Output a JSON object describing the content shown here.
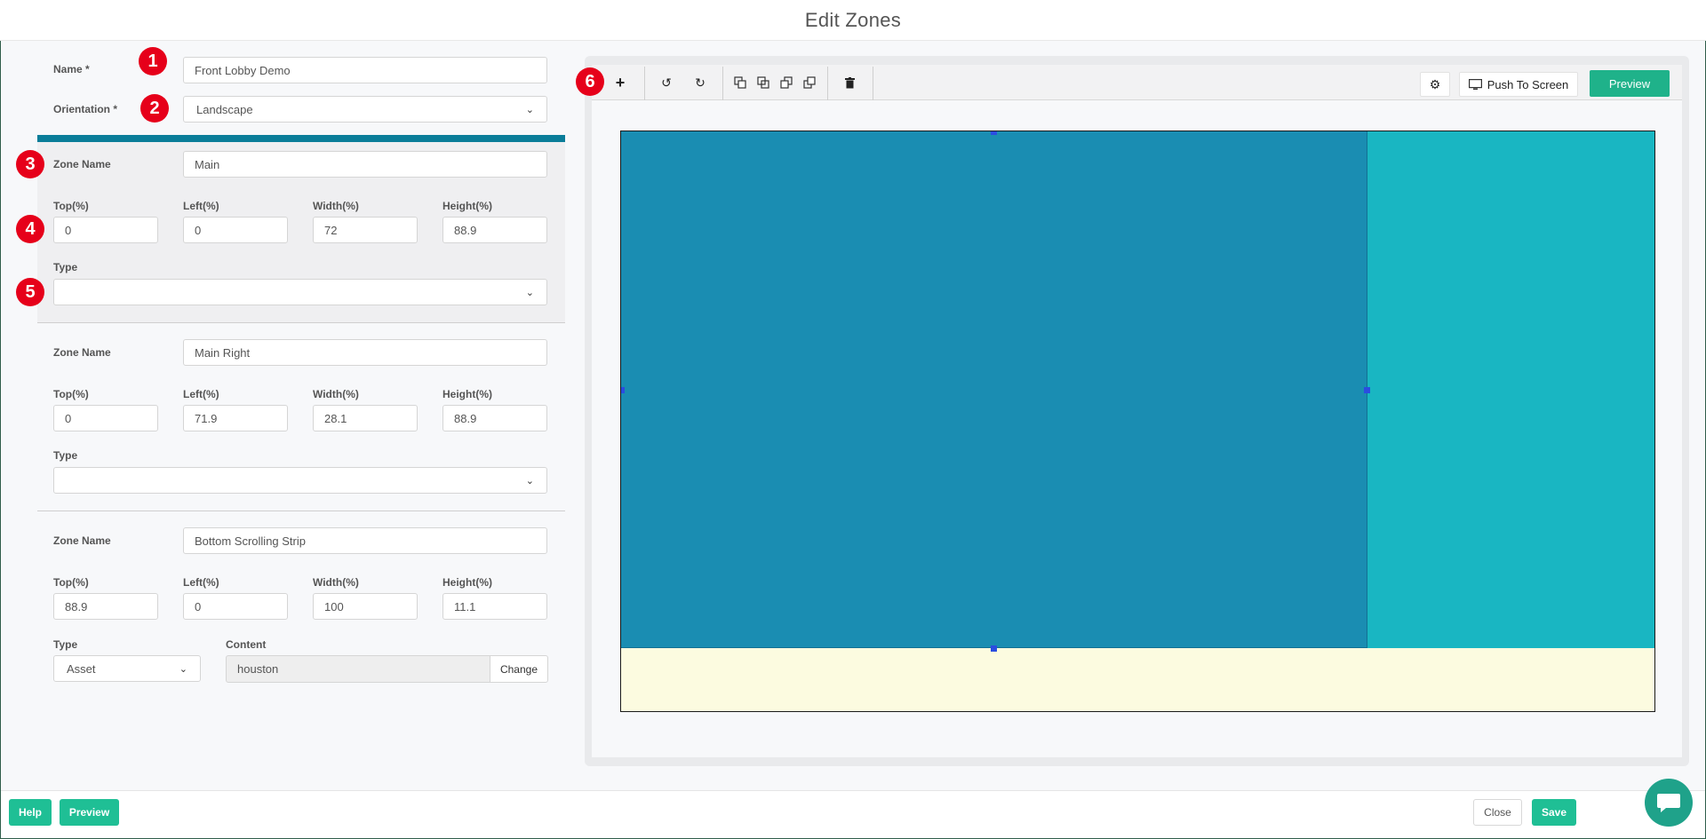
{
  "header": {
    "title": "Edit Zones"
  },
  "form": {
    "name_label": "Name *",
    "name_value": "Front Lobby Demo",
    "orientation_label": "Orientation *",
    "orientation_value": "Landscape"
  },
  "zones": [
    {
      "zone_name_label": "Zone Name",
      "zone_name": "Main",
      "top_label": "Top(%)",
      "top": "0",
      "left_label": "Left(%)",
      "left": "0",
      "width_label": "Width(%)",
      "width": "72",
      "height_label": "Height(%)",
      "height": "88.9",
      "type_label": "Type",
      "type": ""
    },
    {
      "zone_name_label": "Zone Name",
      "zone_name": "Main Right",
      "top_label": "Top(%)",
      "top": "0",
      "left_label": "Left(%)",
      "left": "71.9",
      "width_label": "Width(%)",
      "width": "28.1",
      "height_label": "Height(%)",
      "height": "88.9",
      "type_label": "Type",
      "type": ""
    },
    {
      "zone_name_label": "Zone Name",
      "zone_name": "Bottom Scrolling Strip",
      "top_label": "Top(%)",
      "top": "88.9",
      "left_label": "Left(%)",
      "left": "0",
      "width_label": "Width(%)",
      "width": "100",
      "height_label": "Height(%)",
      "height": "11.1",
      "type_label": "Type",
      "type": "Asset",
      "content_label": "Content",
      "content": "houston",
      "change_label": "Change"
    }
  ],
  "badges": [
    "1",
    "2",
    "3",
    "4",
    "5",
    "6"
  ],
  "toolbar": {
    "add_icon": "+",
    "undo_icon": "↺",
    "redo_icon": "↻",
    "delete_icon": "🗑",
    "settings_icon": "⚙",
    "push_label": "Push To Screen",
    "preview_label": "Preview"
  },
  "footer": {
    "help_label": "Help",
    "preview_label": "Preview",
    "close_label": "Close",
    "save_label": "Save"
  },
  "colors": {
    "zone_main": "#1a8db2",
    "zone_right": "#19b6c2",
    "zone_bottom": "#fcfbe0",
    "accent_green": "#1fbf95",
    "accent_teal": "#0a7d99",
    "badge_red": "#e6001a"
  }
}
